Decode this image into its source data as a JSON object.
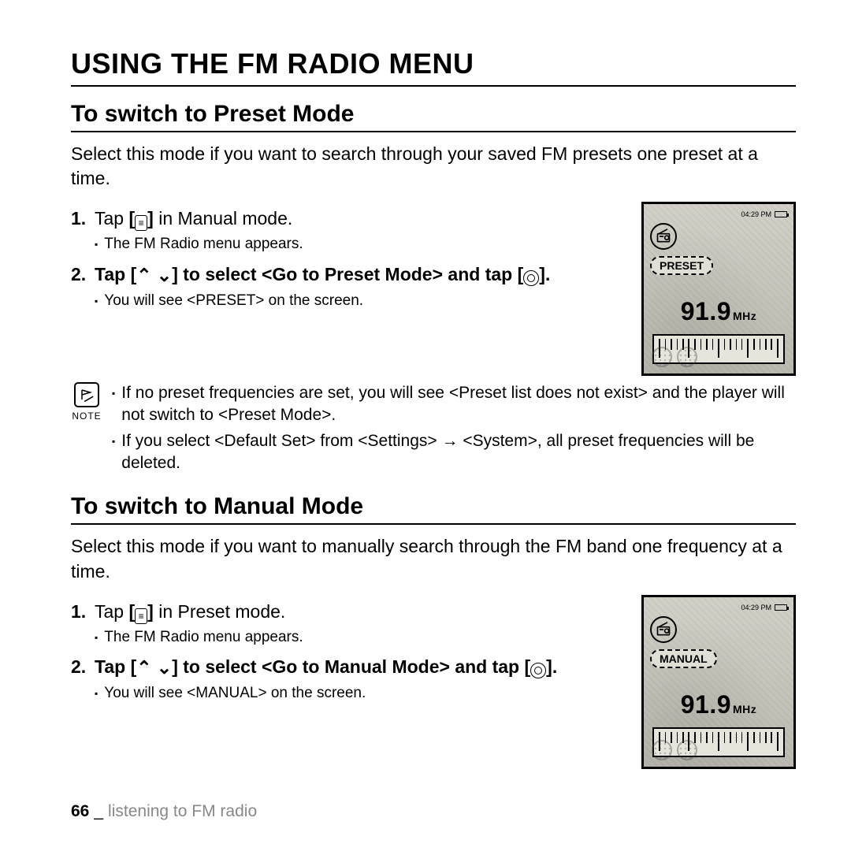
{
  "page_title": "USING THE FM RADIO MENU",
  "sections": {
    "preset": {
      "title": "To switch to Preset Mode",
      "intro": "Select this mode if you want to search through your saved FM presets one preset at a time.",
      "step1_a": "Tap ",
      "step1_b": " in Manual mode.",
      "step1_sub": "The FM Radio menu appears.",
      "step2_a": "Tap ",
      "step2_b": " to select ",
      "step2_c": "<Go to Preset Mode>",
      "step2_d": " and tap ",
      "step2_e": ".",
      "step2_sub": "You will see <PRESET> on the screen.",
      "note1": "If no preset frequencies are set, you will see <Preset list does not exist> and the player will not switch to <Preset Mode>.",
      "note2": "If you select <Default Set> from <Settings> → <System>, all preset frequencies will be deleted."
    },
    "manual": {
      "title": "To switch to Manual Mode",
      "intro": "Select this mode if you want to manually search through the FM band one frequency at a time.",
      "step1_a": "Tap ",
      "step1_b": " in Preset mode.",
      "step1_sub": "The FM Radio menu appears.",
      "step2_a": "Tap ",
      "step2_b": " to select ",
      "step2_c": "<Go to Manual Mode>",
      "step2_d": " and tap ",
      "step2_e": ".",
      "step2_sub": "You will see <MANUAL> on the screen."
    }
  },
  "note_label": "NOTE",
  "icons": {
    "menu": "≡",
    "updown_open": "[",
    "updown_close": "]",
    "confirm_open": "[",
    "confirm_close": "]"
  },
  "device": {
    "time": "04:29 PM",
    "mode_preset": "PRESET",
    "mode_manual": "MANUAL",
    "frequency": "91.9",
    "unit": "MHz"
  },
  "footer": {
    "page": "66",
    "sep": "_",
    "chapter": "listening to FM radio"
  }
}
